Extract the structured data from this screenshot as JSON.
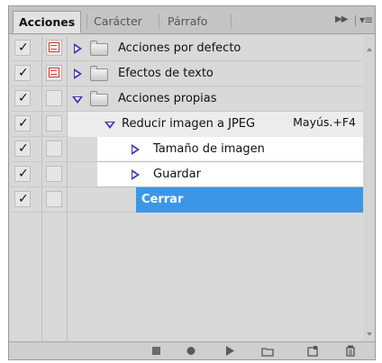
{
  "tabs": [
    {
      "label": "Acciones",
      "active": true
    },
    {
      "label": "Carácter",
      "active": false
    },
    {
      "label": "Párrafo",
      "active": false
    }
  ],
  "panel_menu": {
    "collapse_icon": "double-arrow-right-icon",
    "menu_icon": "panel-menu-icon"
  },
  "actions": [
    {
      "label": "Acciones por defecto",
      "checked": true,
      "dialog": true,
      "expanded": false,
      "kind": "set"
    },
    {
      "label": "Efectos de texto",
      "checked": true,
      "dialog": true,
      "expanded": false,
      "kind": "set"
    },
    {
      "label": "Acciones propias",
      "checked": true,
      "dialog": false,
      "expanded": true,
      "kind": "set"
    },
    {
      "label": "Reducir imagen a JPEG",
      "shortcut": "Mayús.+F4",
      "checked": true,
      "dialog": false,
      "expanded": true,
      "kind": "action"
    },
    {
      "label": "Tamaño de imagen",
      "checked": true,
      "dialog": false,
      "expanded": false,
      "kind": "step"
    },
    {
      "label": "Guardar",
      "checked": true,
      "dialog": false,
      "expanded": false,
      "kind": "step"
    },
    {
      "label": "Cerrar",
      "checked": true,
      "dialog": false,
      "expanded": false,
      "kind": "step",
      "selected": true
    }
  ],
  "toolbar": {
    "buttons": [
      "stop-icon",
      "record-icon",
      "play-icon",
      "new-set-icon",
      "new-action-icon",
      "delete-icon"
    ]
  },
  "colors": {
    "selection": "#3c96e6",
    "dialog_icon": "#d43a2a",
    "triangle": "#3b3bb5"
  }
}
